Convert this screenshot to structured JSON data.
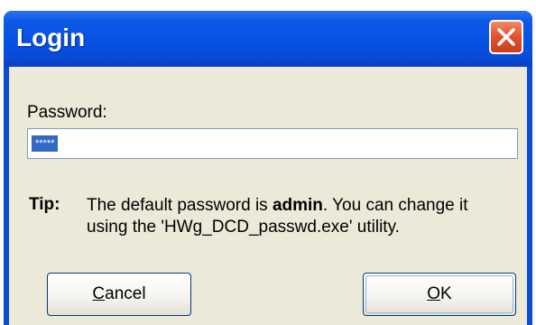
{
  "window": {
    "title": "Login"
  },
  "password": {
    "label": "Password:",
    "value": "*****"
  },
  "tip": {
    "label": "Tip:",
    "text_before": "The default password is ",
    "text_bold": "admin",
    "text_after": ". You can change it using the 'HWg_DCD_passwd.exe' utility."
  },
  "buttons": {
    "cancel_mnemonic": "C",
    "cancel_rest": "ancel",
    "ok_mnemonic": "O",
    "ok_rest": "K"
  },
  "colors": {
    "titlebar": "#0552e3",
    "close": "#e0502a",
    "dialog_bg": "#ece9d8",
    "selection": "#316ac5"
  },
  "icons": {
    "close": "close-icon"
  }
}
